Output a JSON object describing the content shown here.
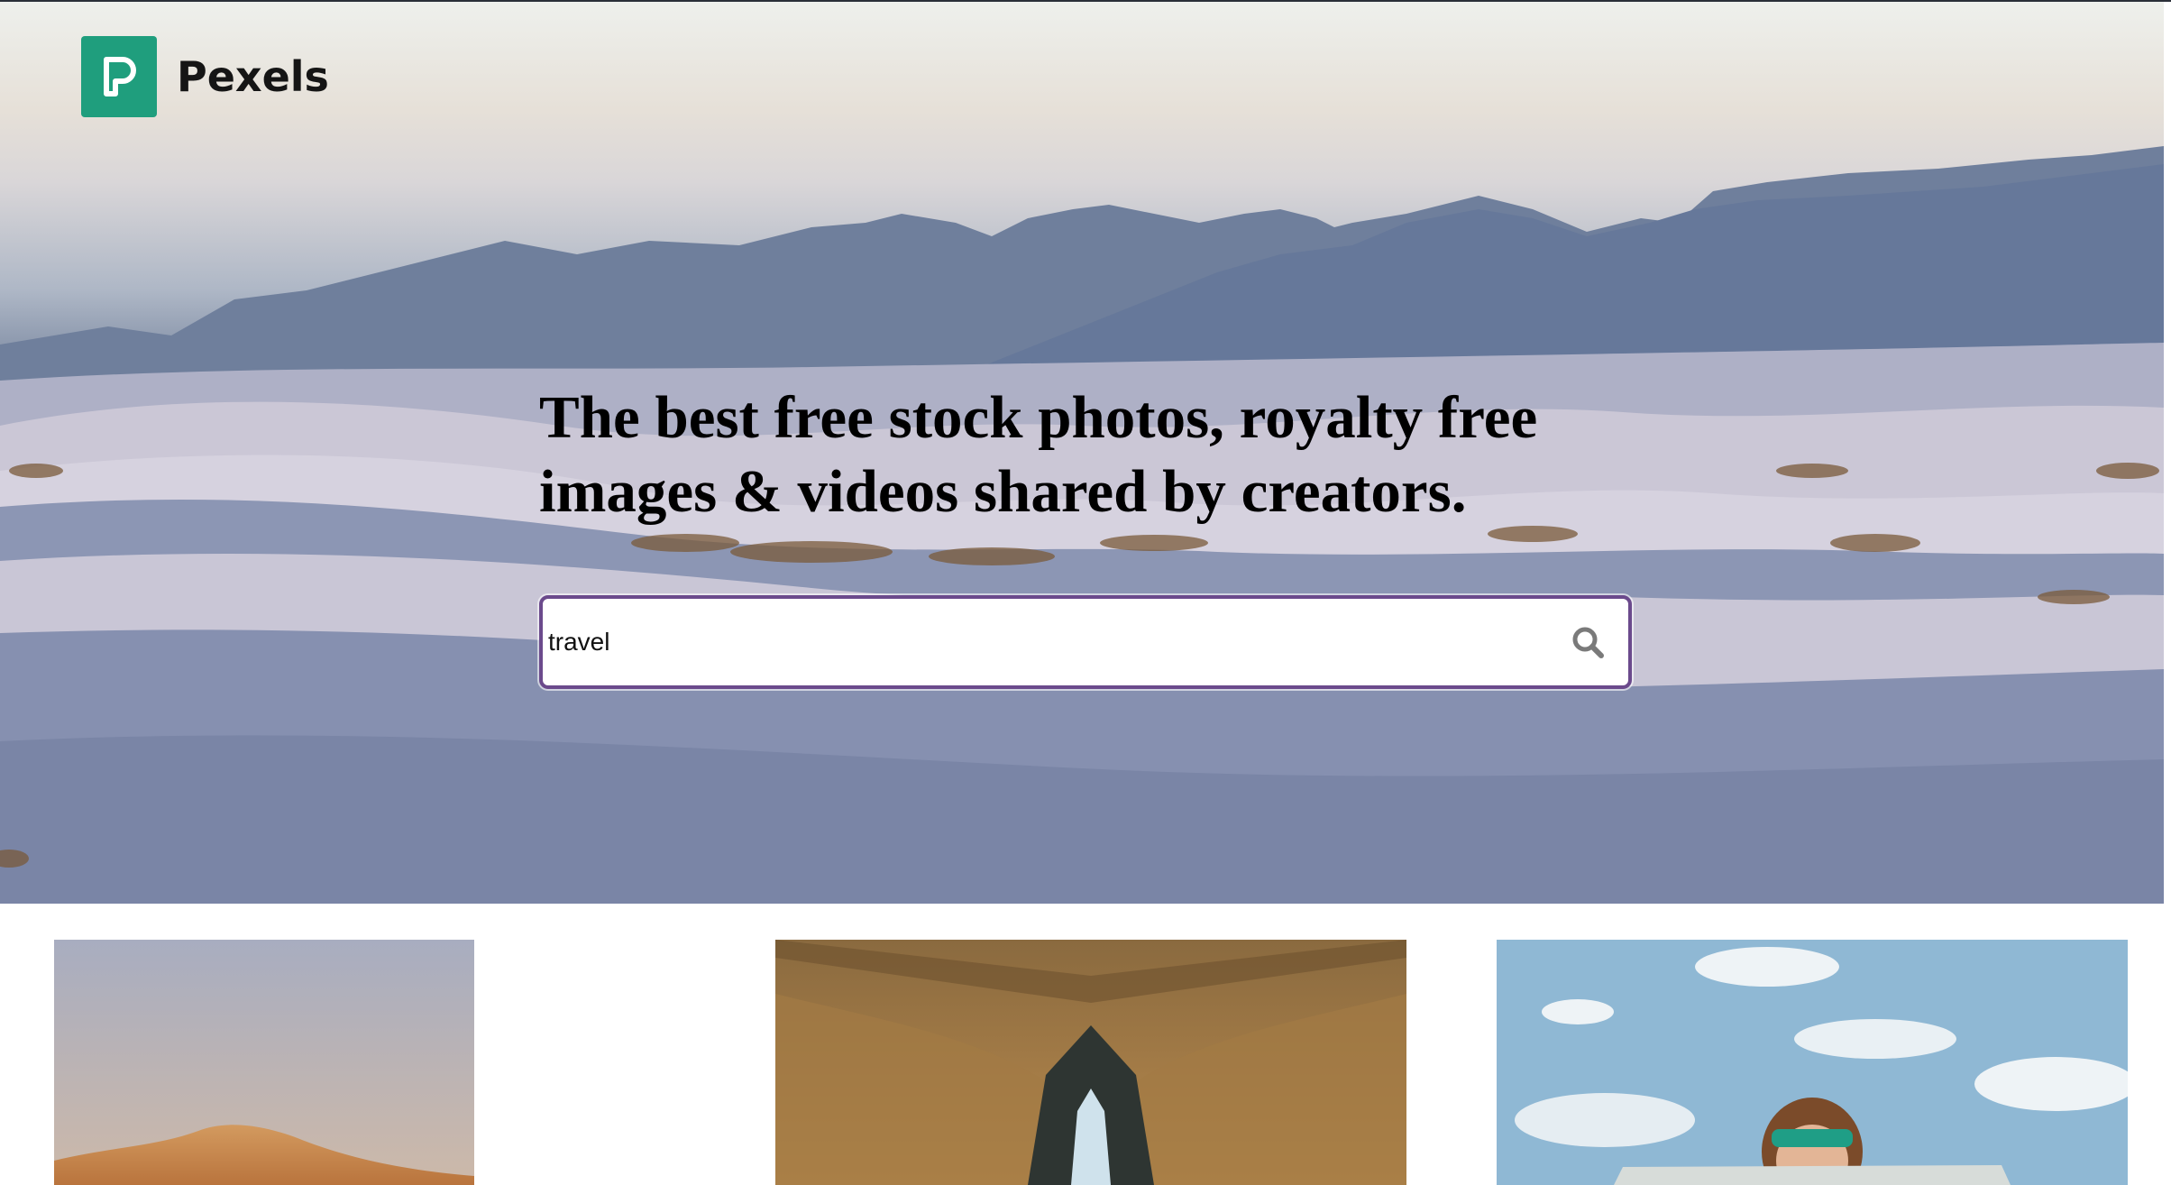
{
  "header": {
    "logo_text": "Pexels"
  },
  "hero": {
    "headline": "The best free stock photos, royalty free images & videos shared by creators."
  },
  "search": {
    "value": "travel"
  },
  "icons": {
    "logo": "pexels-logo-icon",
    "search": "search-icon"
  },
  "colors": {
    "brand": "#1f9e7d",
    "search_border": "#6b4a8c"
  },
  "photos": [
    {
      "subject": "desert-dune"
    },
    {
      "subject": "tent-interior"
    },
    {
      "subject": "woman-reading-map"
    }
  ]
}
